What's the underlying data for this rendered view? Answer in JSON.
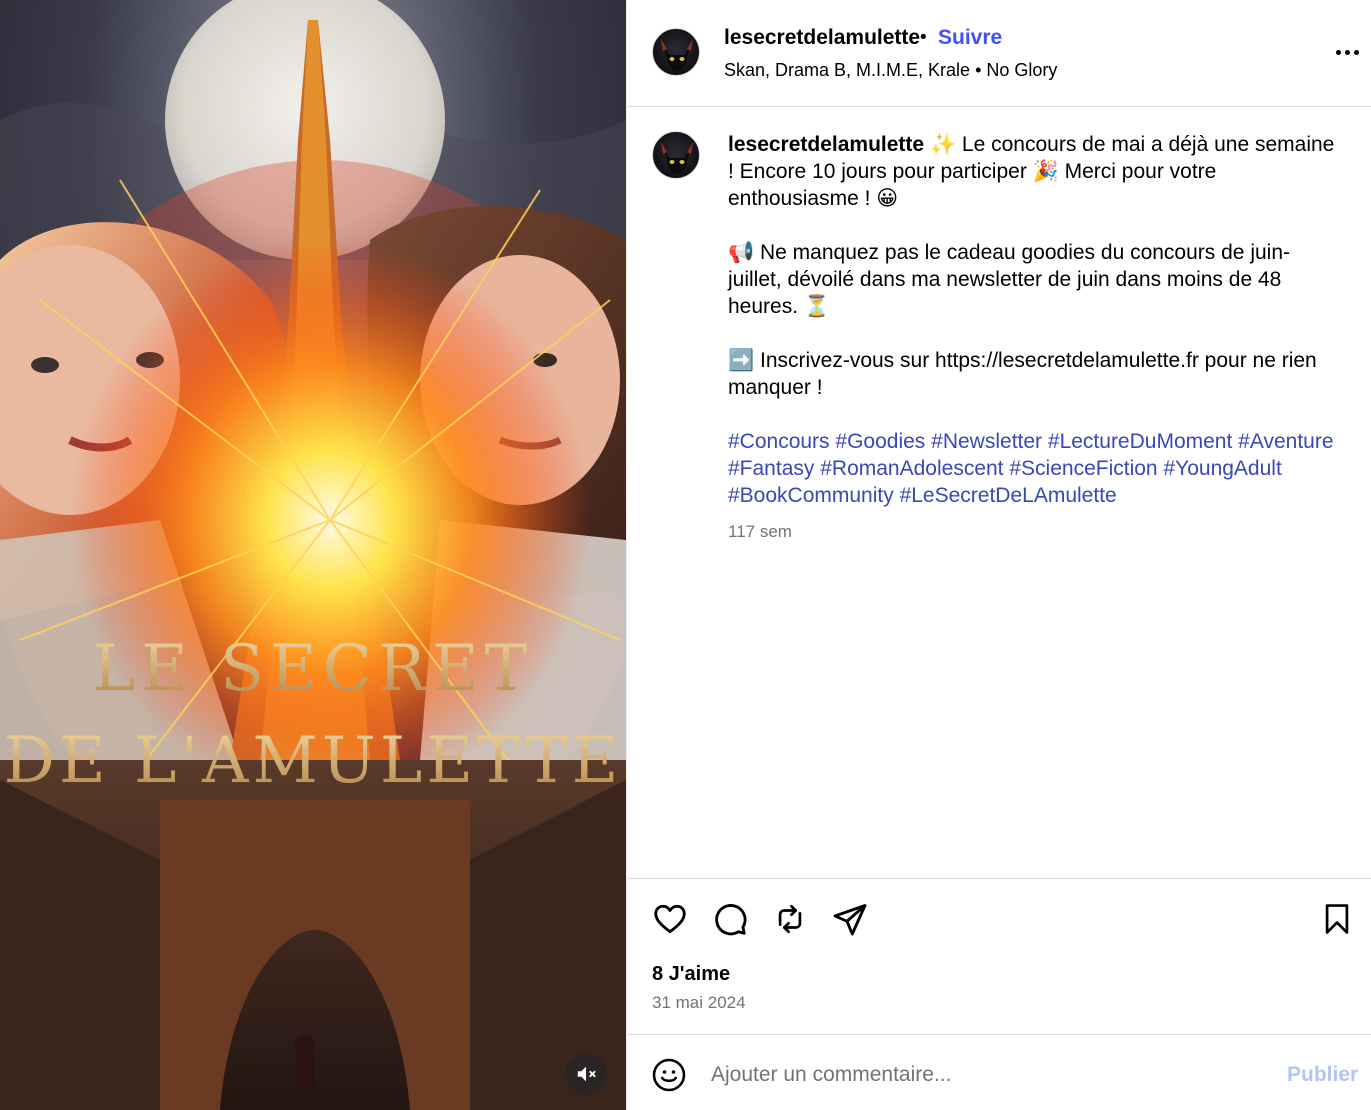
{
  "post": {
    "username": "lesecretdelamulette",
    "separator": "•",
    "follow_label": "Suivre",
    "audio_line": "Skan, Drama B, M.I.M.E, Krale • No Glory",
    "media": {
      "poster_title_line1": "LE SECRET",
      "poster_title_line2": "DE L'AMULETTE",
      "mute_icon": "speaker-muted-icon"
    }
  },
  "caption": {
    "username": "lesecretdelamulette",
    "lines": [
      "✨ Le concours de mai a déjà une semaine ! Encore 10 jours pour participer 🎉 Merci pour votre enthousiasme ! 😀",
      "📢 Ne manquez pas le cadeau goodies du concours de juin-juillet, dévoilé dans ma newsletter de juin dans moins de 48 heures. ⏳",
      "➡️ Inscrivez-vous sur https://lesecretdelamulette.fr pour ne rien manquer !"
    ],
    "hashtags": [
      "#Concours",
      "#Goodies",
      "#Newsletter",
      "#LectureDuMoment",
      "#Aventure",
      "#Fantasy",
      "#RomanAdolescent",
      "#ScienceFiction",
      "#YoungAdult",
      "#BookCommunity",
      "#LeSecretDeLAmulette"
    ],
    "age": "117 sem"
  },
  "actions": {
    "icons": [
      "heart-icon",
      "comment-icon",
      "repost-icon",
      "share-icon",
      "bookmark-icon"
    ],
    "likes": "8 J'aime",
    "date": "31 mai 2024"
  },
  "comment": {
    "placeholder": "Ajouter un commentaire...",
    "publish_label": "Publier"
  },
  "colors": {
    "link_blue": "#4150f7",
    "hashtag_blue": "#3848b8",
    "publish_disabled": "#b3c4f7",
    "muted_text": "#737373",
    "divider": "#dbdbdb"
  }
}
